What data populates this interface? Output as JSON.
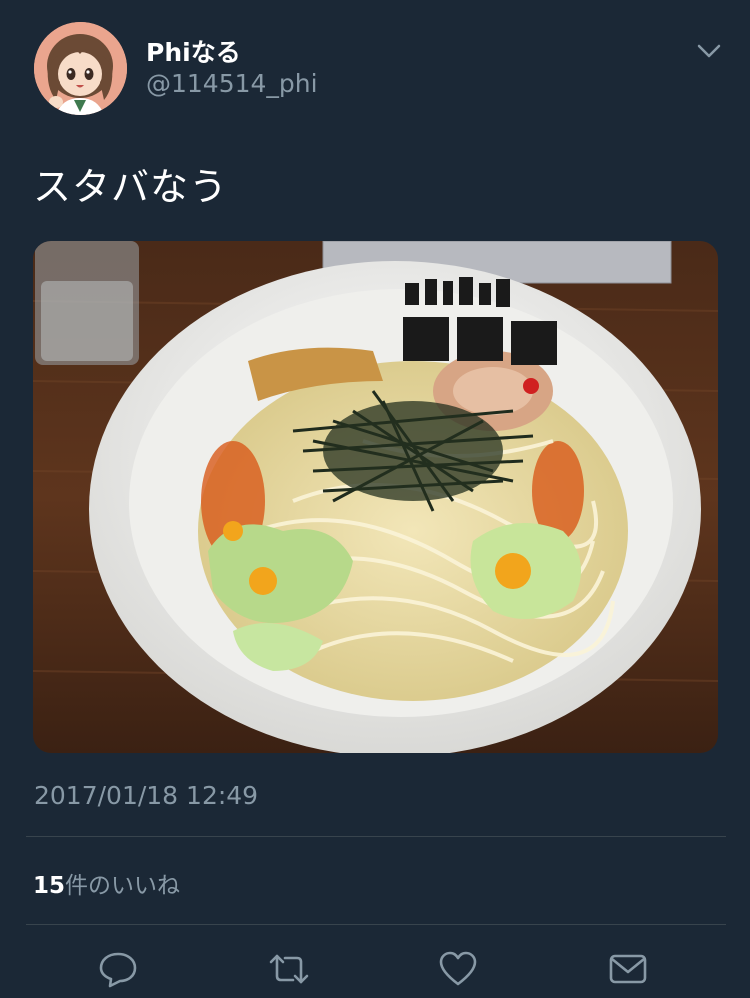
{
  "author": {
    "display_name": "Phiなる",
    "handle": "@114514_phi",
    "avatar_icon": "avatar-anime-girl"
  },
  "tweet": {
    "text": "スタバなう",
    "photo_icon": "photo-ramen-bowl",
    "timestamp": "2017/01/18 12:49"
  },
  "stats": {
    "likes_count": "15",
    "likes_suffix": "件のいいね"
  },
  "actions": [
    {
      "icon": "reply-icon"
    },
    {
      "icon": "retweet-icon"
    },
    {
      "icon": "like-icon"
    },
    {
      "icon": "message-icon"
    }
  ],
  "colors": {
    "background": "#1b2836",
    "secondary_text": "#8899a6",
    "divider": "#38444d"
  }
}
